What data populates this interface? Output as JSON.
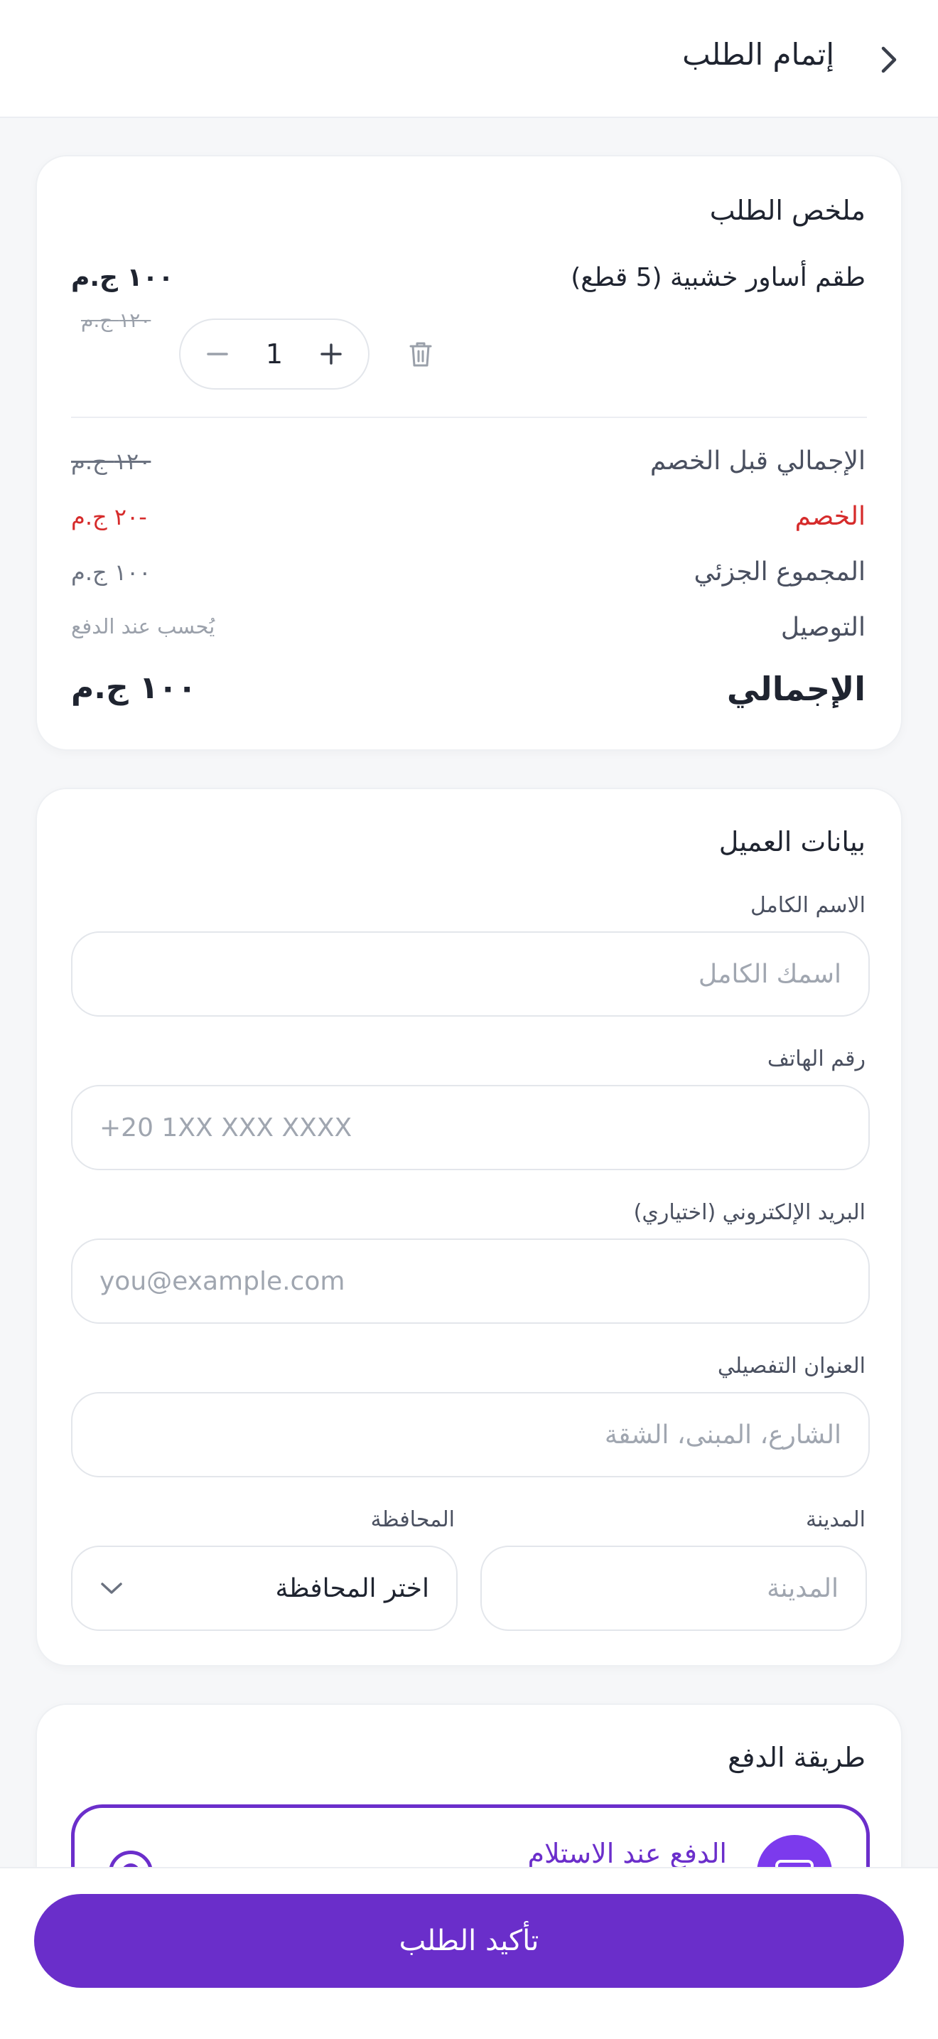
{
  "header": {
    "title": "إتمام الطلب",
    "back_icon": "chevron-right-icon"
  },
  "summary": {
    "title": "ملخص الطلب",
    "item": {
      "name": "طقم أساور خشبية (5 قطع)",
      "price": "١٠٠ ج.م",
      "old_price": "١٢٠ ج.م",
      "quantity": "1"
    },
    "rows": {
      "before_discount_label": "الإجمالي قبل الخصم",
      "before_discount_value": "١٢٠ ج.م",
      "discount_label": "الخصم",
      "discount_value": "-٢٠ ج.م",
      "subtotal_label": "المجموع الجزئي",
      "subtotal_value": "١٠٠ ج.م",
      "delivery_label": "التوصيل",
      "delivery_value": "يُحسب عند الدفع"
    },
    "total_label": "الإجمالي",
    "total_value": "١٠٠ ج.م"
  },
  "customer": {
    "title": "بيانات العميل",
    "full_name": {
      "label": "الاسم الكامل",
      "placeholder": "اسمك الكامل"
    },
    "phone": {
      "label": "رقم الهاتف",
      "placeholder": "+20 1XX XXX XXXX"
    },
    "email": {
      "label": "البريد الإلكتروني (اختياري)",
      "placeholder": "you@example.com"
    },
    "address": {
      "label": "العنوان التفصيلي",
      "placeholder": "الشارع، المبنى، الشقة"
    },
    "city": {
      "label": "المدينة",
      "placeholder": "المدينة"
    },
    "governorate": {
      "label": "المحافظة",
      "selected": "اختر المحافظة"
    }
  },
  "payment": {
    "title": "طريقة الدفع",
    "option_label": "الدفع عند الاستلام",
    "option_icon": "cash-icon"
  },
  "confirm_label": "تأكيد الطلب",
  "colors": {
    "accent": "#6A2ECA",
    "discount": "#D62B2B"
  }
}
